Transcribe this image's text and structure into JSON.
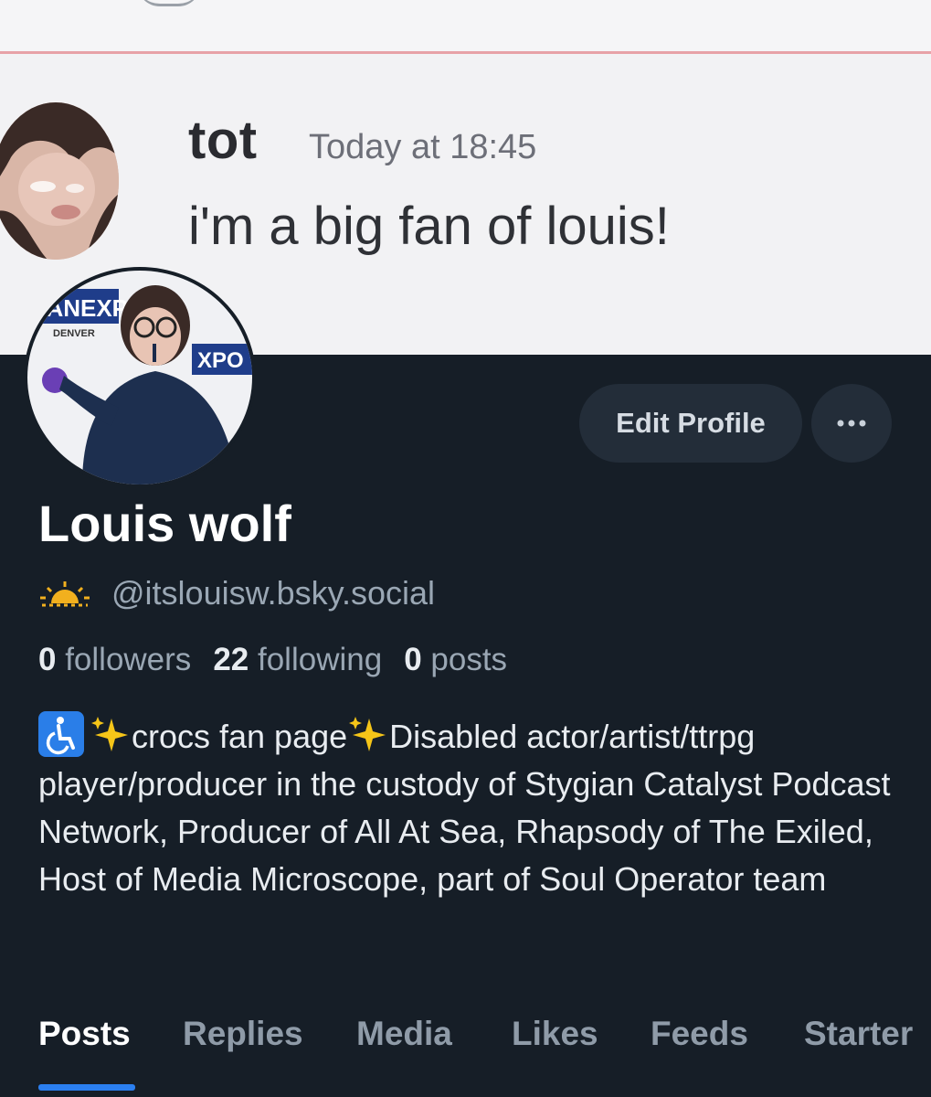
{
  "chat": {
    "author": "tot",
    "timestamp": "Today at 18:45",
    "message": "i'm a big fan of louis!"
  },
  "profile": {
    "avatar_banner_text": "FANEXPO",
    "avatar_banner_sub": "DENVER",
    "avatar_banner_text_2": "XPO",
    "edit_button": "Edit Profile",
    "display_name": "Louis wolf",
    "handle": "@itslouisw.bsky.social",
    "stats": {
      "followers_count": "0",
      "followers_label": "followers",
      "following_count": "22",
      "following_label": "following",
      "posts_count": "0",
      "posts_label": "posts"
    },
    "bio": {
      "segment_1": "crocs fan page",
      "segment_2": "Disabled actor/artist/ttrpg player/producer in the custody of Stygian Catalyst Podcast Network, Producer of All At Sea, Rhapsody of The Exiled, Host of Media Microscope, part of Soul Operator team"
    }
  },
  "tabs": [
    {
      "label": "Posts",
      "active": true
    },
    {
      "label": "Replies"
    },
    {
      "label": "Media"
    },
    {
      "label": "Likes"
    },
    {
      "label": "Feeds"
    },
    {
      "label": "Starter"
    }
  ],
  "icons": {
    "more": "more-horizontal-icon",
    "handle_emoji": "sunrise-icon",
    "wheelchair": "wheelchair-icon",
    "sparkles": "sparkles-icon"
  },
  "colors": {
    "background": "#161e27",
    "button": "#232d39",
    "accent": "#2b7ff0",
    "muted_text": "#9aa7b4"
  }
}
